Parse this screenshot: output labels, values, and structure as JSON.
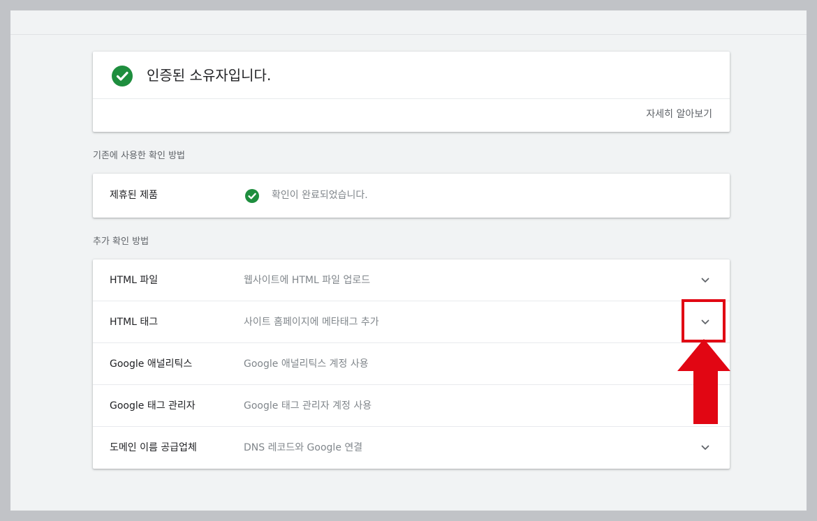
{
  "owner": {
    "title": "인증된 소유자입니다.",
    "learn_more": "자세히 알아보기",
    "icon": "check-circle-icon"
  },
  "previous": {
    "label": "기존에 사용한 확인 방법",
    "method": "제휴된 제품",
    "status": "확인이 완료되었습니다.",
    "icon": "check-circle-icon"
  },
  "additional": {
    "label": "추가 확인 방법",
    "methods": [
      {
        "title": "HTML 파일",
        "description": "웹사이트에 HTML 파일 업로드"
      },
      {
        "title": "HTML 태그",
        "description": "사이트 홈페이지에 메타태그 추가"
      },
      {
        "title": "Google 애널리틱스",
        "description": "Google 애널리틱스 계정 사용"
      },
      {
        "title": "Google 태그 관리자",
        "description": "Google 태그 관리자 계정 사용"
      },
      {
        "title": "도메인 이름 공급업체",
        "description": "DNS 레코드와 Google 연결"
      }
    ],
    "expand_icon": "chevron-down-icon"
  },
  "annotation": {
    "highlight_color": "#e10613",
    "arrow_icon": "arrow-up-icon"
  },
  "colors": {
    "success": "#1e8e3e",
    "background": "#f1f3f4",
    "frame": "#c1c3c7"
  }
}
